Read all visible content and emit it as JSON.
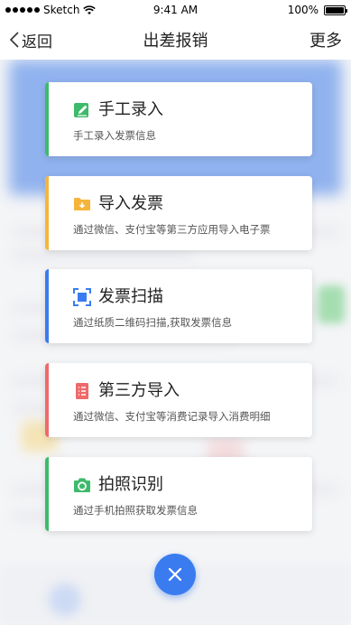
{
  "status_bar": {
    "carrier": "Sketch",
    "time": "9:41 AM",
    "battery": "100%"
  },
  "nav": {
    "back_label": "返回",
    "title": "出差报销",
    "more_label": "更多"
  },
  "options": [
    {
      "title": "手工录入",
      "desc": "手工录入发票信息",
      "color": "#3dba6a",
      "icon": "edit-icon"
    },
    {
      "title": "导入发票",
      "desc": "通过微信、支付宝等第三方应用导入电子票",
      "color": "#f5b53a",
      "icon": "folder-download-icon"
    },
    {
      "title": "发票扫描",
      "desc": "通过纸质二维码扫描,获取发票信息",
      "color": "#3a7cf0",
      "icon": "scan-icon"
    },
    {
      "title": "第三方导入",
      "desc": "通过微信、支付宝等消费记录导入消费明细",
      "color": "#ef6a6a",
      "icon": "list-icon"
    },
    {
      "title": "拍照识别",
      "desc": "通过手机拍照获取发票信息",
      "color": "#3dba6a",
      "icon": "camera-icon"
    }
  ],
  "close_icon": "close-icon"
}
